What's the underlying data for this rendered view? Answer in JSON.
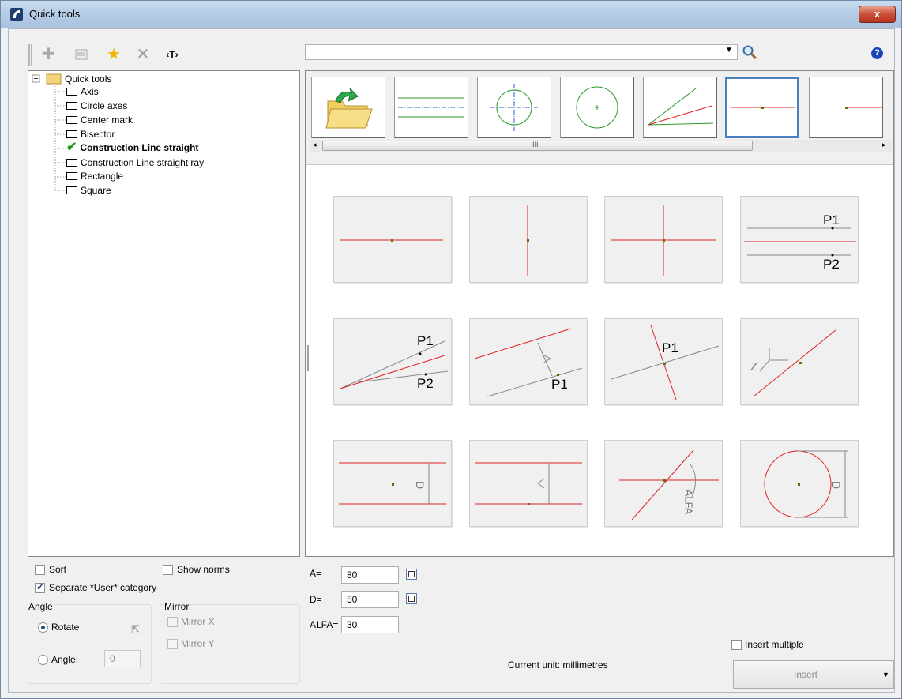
{
  "window": {
    "title": "Quick tools",
    "close_label": "x"
  },
  "toolbar": {
    "icons": [
      "grip-icon",
      "plus-icon",
      "properties-icon",
      "favorite-star-icon",
      "delete-x-icon",
      "text-tag-icon"
    ],
    "text_tag_label": "‹T›",
    "help_label": "?",
    "search_value": ""
  },
  "tree": {
    "root": "Quick tools",
    "items": [
      {
        "label": "Axis",
        "selected": false
      },
      {
        "label": "Circle axes",
        "selected": false
      },
      {
        "label": "Center mark",
        "selected": false
      },
      {
        "label": "Bisector",
        "selected": false
      },
      {
        "label": "Construction Line straight",
        "selected": true
      },
      {
        "label": "Construction Line straight ray",
        "selected": false
      },
      {
        "label": "Rectangle",
        "selected": false
      },
      {
        "label": "Square",
        "selected": false
      }
    ]
  },
  "gallery": {
    "scroll_grip": "III",
    "thumbnails": [
      "open-folder",
      "axis",
      "circle-axes",
      "center-mark",
      "bisector",
      "construction-line-straight",
      "construction-line-straight-ray"
    ],
    "selected_thumbnail": "construction-line-straight"
  },
  "variants": {
    "labels": {
      "p1": "P1",
      "p2": "P2",
      "z": "Z",
      "d": "D",
      "alfa": "ALFA"
    }
  },
  "options": {
    "sort_label": "Sort",
    "sort_checked": false,
    "show_norms_label": "Show norms",
    "show_norms_checked": false,
    "separate_user_label": "Separate *User* category",
    "separate_user_checked": true,
    "angle_group_label": "Angle",
    "rotate_label": "Rotate",
    "angle_label": "Angle:",
    "angle_value": "0",
    "mirror_group_label": "Mirror",
    "mirror_x_label": "Mirror X",
    "mirror_y_label": "Mirror Y"
  },
  "params": {
    "a_label": "A=",
    "a_value": "80",
    "d_label": "D=",
    "d_value": "50",
    "alfa_label": "ALFA=",
    "alfa_value": "30"
  },
  "footer": {
    "insert_multiple_label": "Insert multiple",
    "insert_multiple_checked": false,
    "current_unit": "Current unit: millimetres",
    "insert_label": "Insert"
  }
}
